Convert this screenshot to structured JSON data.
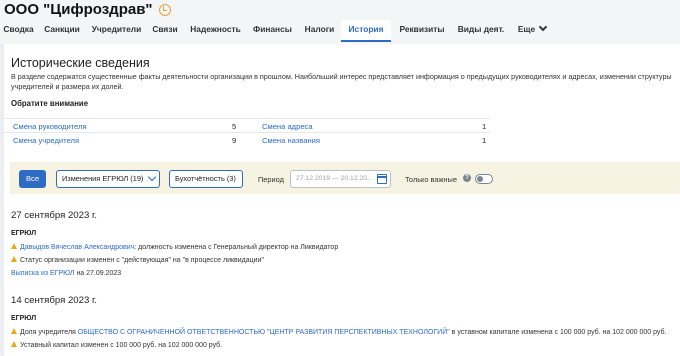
{
  "company": {
    "name": "ООО \"Цифроздрав\"",
    "status_icon": "pending-icon"
  },
  "tabs": [
    {
      "label": "Сводка"
    },
    {
      "label": "Санкции"
    },
    {
      "label": "Учредители"
    },
    {
      "label": "Связи"
    },
    {
      "label": "Надежность"
    },
    {
      "label": "Финансы"
    },
    {
      "label": "Налоги"
    },
    {
      "label": "История",
      "active": true
    },
    {
      "label": "Реквизиты"
    },
    {
      "label": "Виды деят."
    },
    {
      "label": "Еще"
    }
  ],
  "section": {
    "title": "Исторические сведения",
    "intro": "В разделе содержатся существенные факты деятельности организации в прошлом. Наибольший интерес представляет информация о предыдущих руководителях и адресах, изменении структуры учредителей и размера их долей.",
    "attention": "Обратите внимание"
  },
  "stats": [
    {
      "left_label": "Смена руководителя",
      "left_value": "5",
      "right_label": "Смена адреса",
      "right_value": "1"
    },
    {
      "left_label": "Смена учредителя",
      "left_value": "9",
      "right_label": "Смена названия",
      "right_value": "1"
    }
  ],
  "filters": {
    "all_label": "Все",
    "egrul_select": "Изменения ЕГРЮЛ (19)",
    "accounting_label": "Бухотчётность (3)",
    "period_label": "Период",
    "period_placeholder": "27.12.2019 — 20.12.20...",
    "important_label": "Только важные",
    "help": "?",
    "important_on": false
  },
  "events": [
    {
      "date": "27 сентября 2023 г.",
      "source": "ЕГРЮЛ",
      "items": [
        {
          "link": "Давыдов Вячеслав Александрович",
          "text": ": должность изменена с Генеральный директор на Ликвидатор"
        },
        {
          "link": "",
          "text": "Статус организации изменен с \"действующая\" на \"в процессе ликвидации\""
        }
      ],
      "extract_link": "Выписка из ЕГРЮЛ",
      "extract_text": " на 27.09.2023"
    },
    {
      "date": "14 сентября 2023 г.",
      "source": "ЕГРЮЛ",
      "items": [
        {
          "prefix": "Доля учредителя ",
          "link": "ОБЩЕСТВО С ОГРАНИЧЕННОЙ ОТВЕТСТВЕННОСТЬЮ \"ЦЕНТР РАЗВИТИЯ ПЕРСПЕКТИВНЫХ ТЕХНОЛОГИЙ\"",
          "text": " в уставном капитале изменена с 100 000 руб. на 102 000 000 руб."
        },
        {
          "prefix": "",
          "link": "",
          "text": "Уставный капитал изменен с 100 000 руб. на 102 000 000 руб."
        }
      ]
    }
  ],
  "colors": {
    "accent": "#2d6bc4",
    "warning": "#e8a817",
    "background": "#ebeef2"
  }
}
